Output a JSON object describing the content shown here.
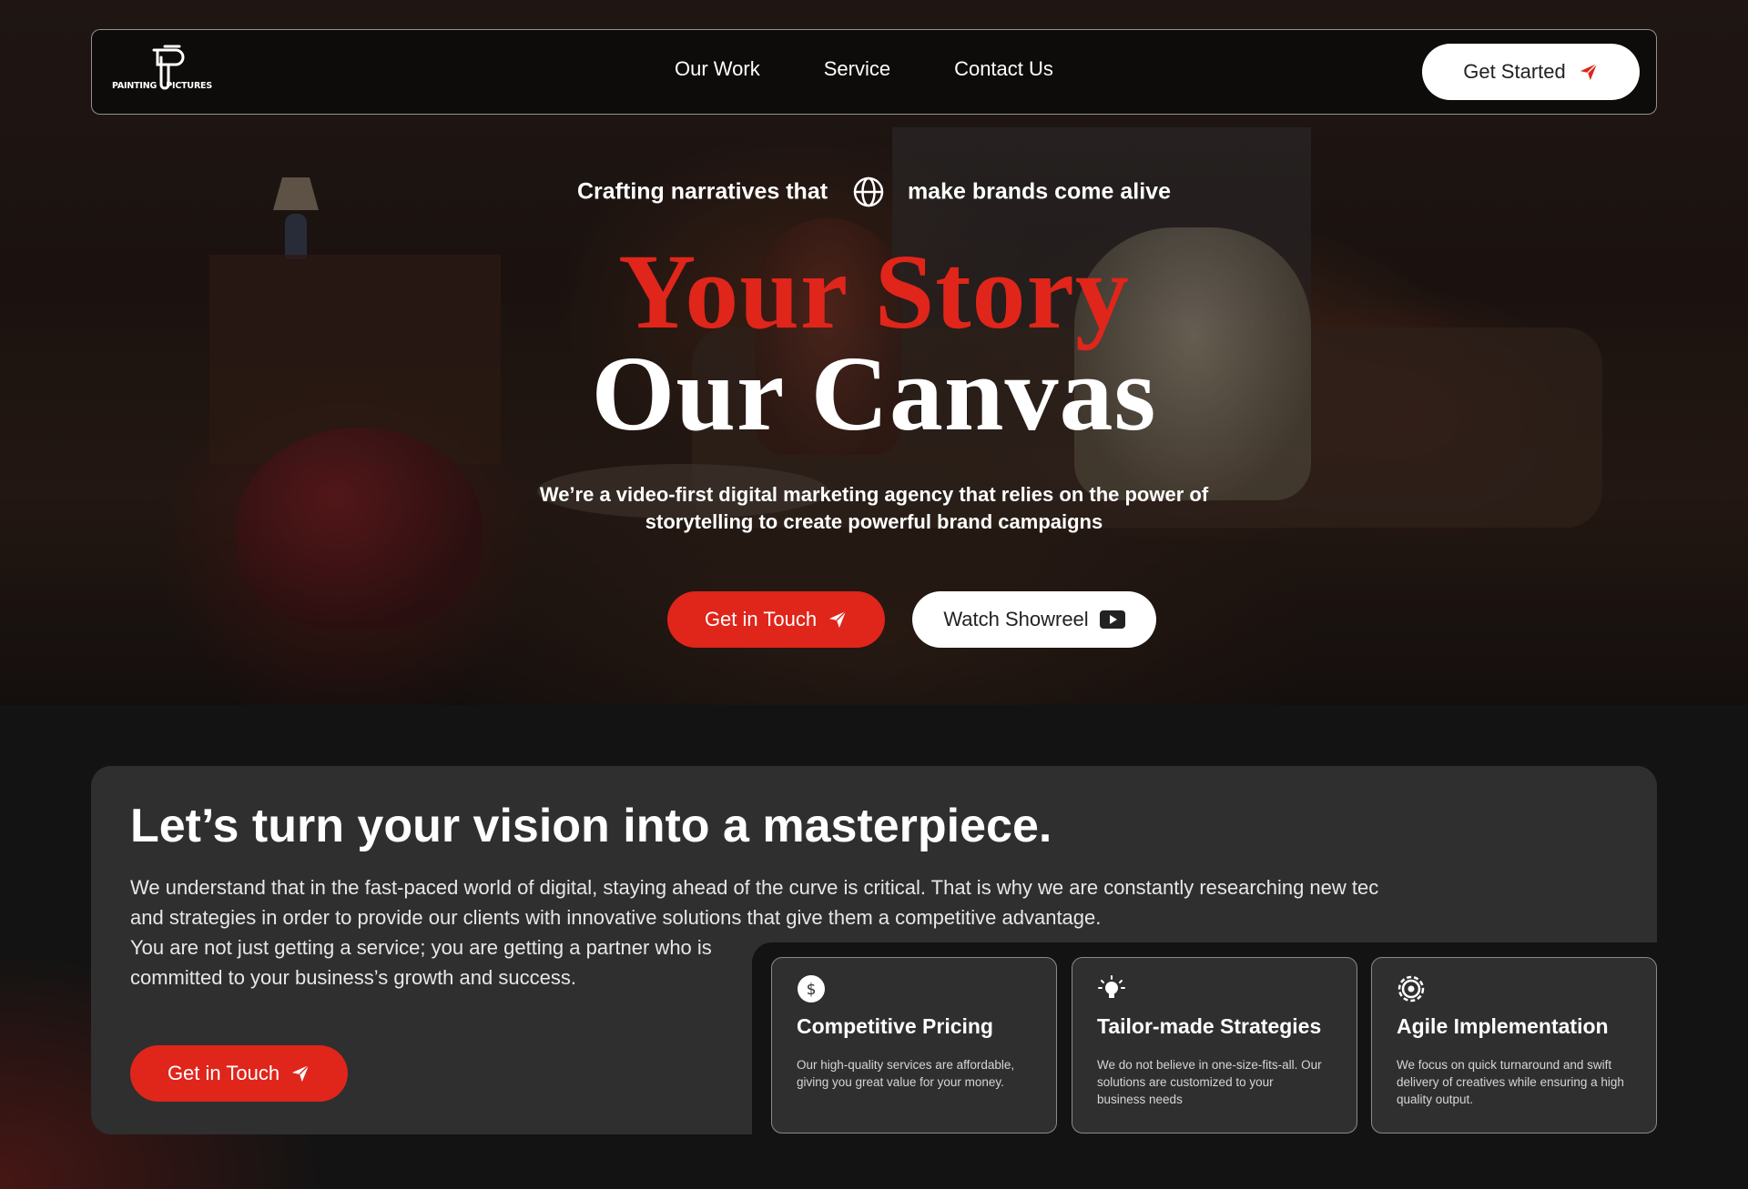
{
  "brand": {
    "logo_left": "PAINTING",
    "logo_right": "PICTURES"
  },
  "nav": {
    "links": [
      "Our Work",
      "Service",
      "Contact Us"
    ],
    "cta_label": "Get Started"
  },
  "hero": {
    "tagline_left": "Crafting narratives that",
    "tagline_right": "make brands come alive",
    "title_line1": "Your Story",
    "title_line2": "Our Canvas",
    "lead": "We’re a video-first digital marketing agency that relies on the power of storytelling to create powerful brand campaigns",
    "primary_btn": "Get in Touch",
    "secondary_btn": "Watch Showreel"
  },
  "about": {
    "heading": "Let’s turn your vision into a masterpiece.",
    "para1_line1": "We understand that in the fast-paced world of digital, staying ahead of the curve is critical. That is why we are constantly researching new tec",
    "para1_line2": "and strategies in order to provide our clients with innovative solutions that give them a competitive advantage.",
    "para2": "You are not just getting a service; you are getting a partner who is committed to your business’s growth and success.",
    "btn": "Get in Touch"
  },
  "features": [
    {
      "icon": "dollar-icon",
      "title": "Competitive Pricing",
      "text": "Our high-quality services are affordable, giving you great value for your money."
    },
    {
      "icon": "lightbulb-icon",
      "title": "Tailor-made Strategies",
      "text": "We do not believe in one-size-fits-all. Our solutions are customized to your business needs"
    },
    {
      "icon": "gear-icon",
      "title": "Agile Implementation",
      "text": "We focus on quick turnaround and swift delivery of creatives while ensuring a high quality output."
    }
  ],
  "colors": {
    "accent": "#e0251b",
    "card_bg": "#2f2f2f",
    "page_bg": "#141313"
  }
}
